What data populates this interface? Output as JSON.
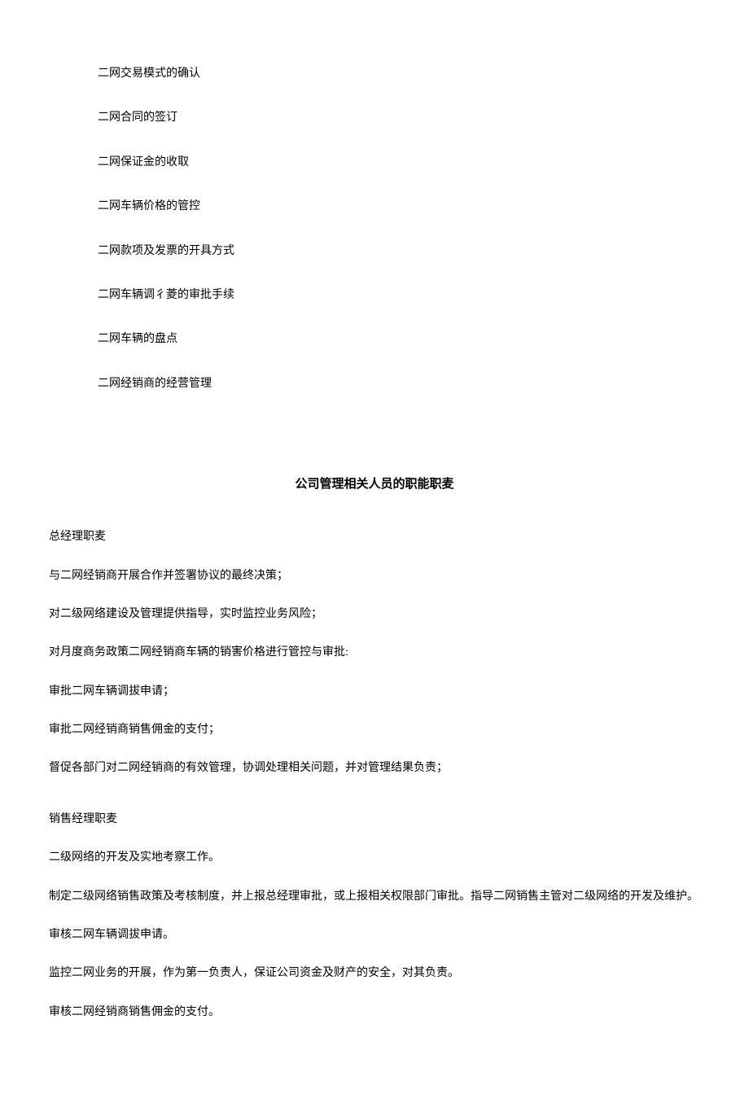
{
  "list": {
    "items": [
      "二网交易模式的确认",
      "二网合同的签订",
      "二网保证金的收取",
      "二网车辆价格的管控",
      "二网款项及发票的开具方式",
      "二网车辆调彳菱的审批手续",
      "二网车辆的盘点",
      "二网经销商的经营管理"
    ]
  },
  "title": "公司管理相关人员的职能职麦",
  "role1": {
    "heading": "总经理职麦",
    "items": [
      "与二网经销商开展合作并签署协议的最终决策；",
      "对二级网络建设及管理提供指导，实时监控业务风险；",
      "对月度商务政策二网经销商车辆的销害价格进行管控与审批:",
      "审批二网车辆调拔申请；",
      "审批二网经销商销售佣金的支付；",
      "督促各部门对二网经销商的有效管理，协调处理相关问题，并对管理结果负责；"
    ]
  },
  "role2": {
    "heading": "销售经理职麦",
    "items": [
      "二级网络的开发及实地考察工作。",
      "制定二级网络销售政策及考核制度，并上报总经理审批，或上报相关权限部门审批。指导二网销售主管对二级网络的开发及维护。",
      "审核二网车辆调拔申请。",
      "监控二网业务的开展，作为第一负责人，保证公司资金及财产的安全，对其负责。",
      "审核二网经销商销售佣金的支付。"
    ]
  }
}
